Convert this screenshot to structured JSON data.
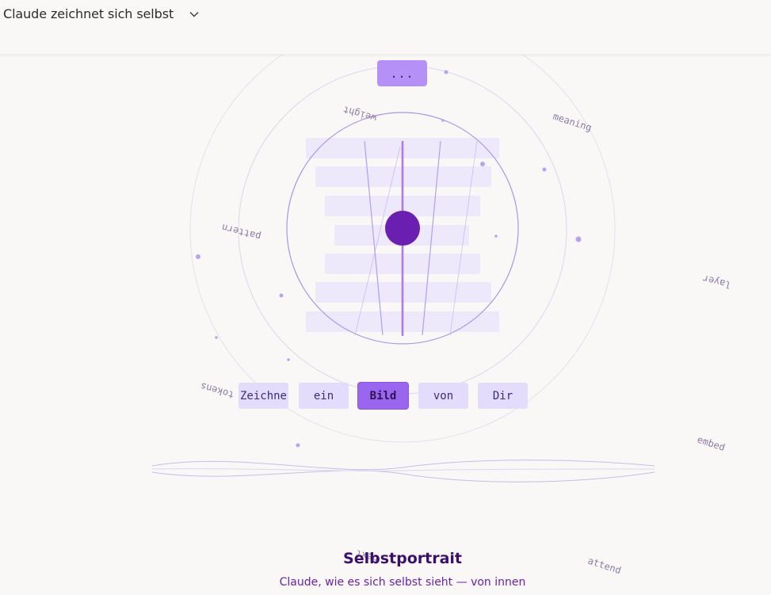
{
  "header": {
    "title": "Claude zeichnet sich selbst",
    "menu_icon": "chevron-down-icon"
  },
  "top_button": {
    "label": "..."
  },
  "tokens": [
    {
      "label": "Zeichne",
      "active": false
    },
    {
      "label": "ein",
      "active": false
    },
    {
      "label": "Bild",
      "active": true
    },
    {
      "label": "von",
      "active": false
    },
    {
      "label": "Dir",
      "active": false
    }
  ],
  "floating_words": [
    "weight",
    "meaning",
    "pattern",
    "layer",
    "tokens",
    "embed",
    "next",
    "attend"
  ],
  "caption": {
    "title": "Selbstportrait",
    "subtitle": "Claude, wie es sich selbst sieht — von innen"
  },
  "colors": {
    "accent": "#9b66ee",
    "core": "#6a1fb0",
    "token_bg": "#e3dcfb",
    "ring": "#a995e8",
    "word": "#8b7aa8"
  }
}
